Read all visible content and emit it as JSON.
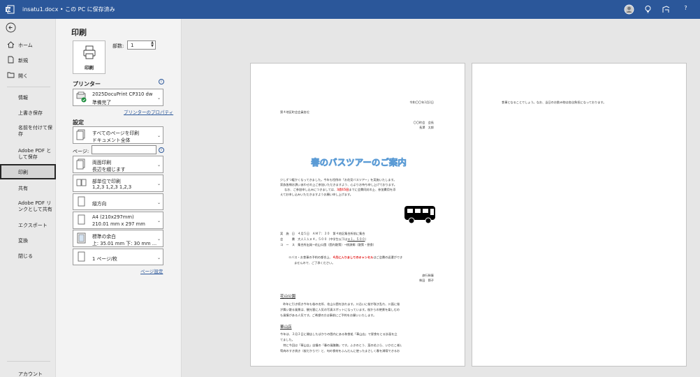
{
  "titlebar": {
    "doc_title": "insatu1.docx • この PC に保存済み",
    "icons": [
      "word-app-icon",
      "account-avatar-icon",
      "lightbulb-icon",
      "coauthor-icon",
      "help-icon"
    ],
    "help_label": "?"
  },
  "nav": {
    "back_icon": "back-arrow-icon",
    "items": [
      {
        "label": "ホーム",
        "icon": "home-icon"
      },
      {
        "label": "新規",
        "icon": "new-document-icon"
      },
      {
        "label": "開く",
        "icon": "open-folder-icon"
      },
      {
        "label": "情報"
      },
      {
        "label": "上書き保存"
      },
      {
        "label": "名前を付けて保存"
      },
      {
        "label": "Adobe PDF として保存"
      },
      {
        "label": "印刷",
        "selected": true
      },
      {
        "label": "共有"
      },
      {
        "label": "Adobe PDF リンクとして共有"
      },
      {
        "label": "エクスポート"
      },
      {
        "label": "変換"
      },
      {
        "label": "閉じる"
      }
    ],
    "account_label": "アカウント"
  },
  "print": {
    "title": "印刷",
    "print_button": "印刷",
    "copies_label": "部数:",
    "copies_value": "1",
    "printer_section": "プリンター",
    "printer_name": "2025DocuPrint CP310 dw",
    "printer_status": "準備完了",
    "printer_properties": "プリンターのプロパティ",
    "settings_section": "設定",
    "pages_label": "ページ:",
    "pages_value": "",
    "settings": [
      {
        "line1": "すべてのページを印刷",
        "line2": "ドキュメント全体"
      },
      {
        "line1": "両面印刷",
        "line2": "長辺を綴じます"
      },
      {
        "line1": "部単位で印刷",
        "line2": "1,2,3    1,2,3    1,2,3"
      },
      {
        "line1": "縦方向",
        "line2": ""
      },
      {
        "line1": "A4 (210x297mm)",
        "line2": "210.01 mm x 297 mm"
      },
      {
        "line1": "標準の余白",
        "line2": "上: 35.01 mm 下: 30 mm ..."
      },
      {
        "line1": "1 ページ/枚",
        "line2": ""
      }
    ],
    "page_setup_link": "ページ設定"
  },
  "preview": {
    "page1": {
      "date": "令和〇〇年3月2日",
      "recipient": "第４地区町会会員各位",
      "sender1": "〇〇町会　会長",
      "sender2": "長澤　太郎",
      "banner": "春のバスツアーのご案内",
      "body1": "少しずつ暖かくなってきました。今年も恒例の「お花見バスツアー」を実施いたします。",
      "body2": "家族皆様お誘いあわせの上ご参加いただきますよう、心よりお待ち申し上げております。",
      "body3a": "なお、ご参加申し込みにつきましては、",
      "body3red": "3月15日",
      "body3b": "までに会費同封の上、参加費用を添",
      "body4": "えてお申し込みいただきますようお願い申し上げます。",
      "detail1": "実　施　日　４月５日　ＡＭ７：３０　第４地区集合所前に集合",
      "detail2a": "会　　　費　大人１人￥４，５００（中学生以下は",
      "detail2u": "￥１，５００",
      "detail2b": "）",
      "detail3": "コ　ー　ス　集合所出発→花山公園（園内散策）→桃源郷（散策・昼食）",
      "note1a": "※バス・お食事の予約の都合上、",
      "note1red": "４月に入りましてのキャンセル",
      "note1b": "はご会費の返還ができ",
      "note2": "ませんので、ご了承ください。",
      "organizer1": "旅行幹事",
      "organizer2": "柴田　節子",
      "section1_title": "花山公園",
      "section1_line1": "　昨年に引き続き今年も桜の名所、花山公園を訪れます。川沿いに桜が咲き乱れ、川面に桜",
      "section1_line2": "が舞い散る風景は、観光客に人気の写真スポットになっています。桜からの絶景を楽しむの",
      "section1_line3": "も風情がある人気です。ご希望の方は事前にご予約をお願いいたします。",
      "section2_title": "華山店",
      "section2_line1": "今年は、３月３日に開店したばかりの園内にある和食処「華山店」で昼食をとる計画を立",
      "section2_line2": "てました。",
      "section2_line3": "　特に今回は「華山店」自慢の「春の風膳膳」です。ふきのとう、菜の花ぶら、いかだこ巻),",
      "section2_line4": "筍肉のすき焼き（桜だからで）と、旬の食材をふんだんに使ったまさしく春を満喫できるお"
    },
    "page2": {
      "line1": "食事となることでしょう。なお、当日のお飲み物は各自負担になっております。"
    }
  }
}
